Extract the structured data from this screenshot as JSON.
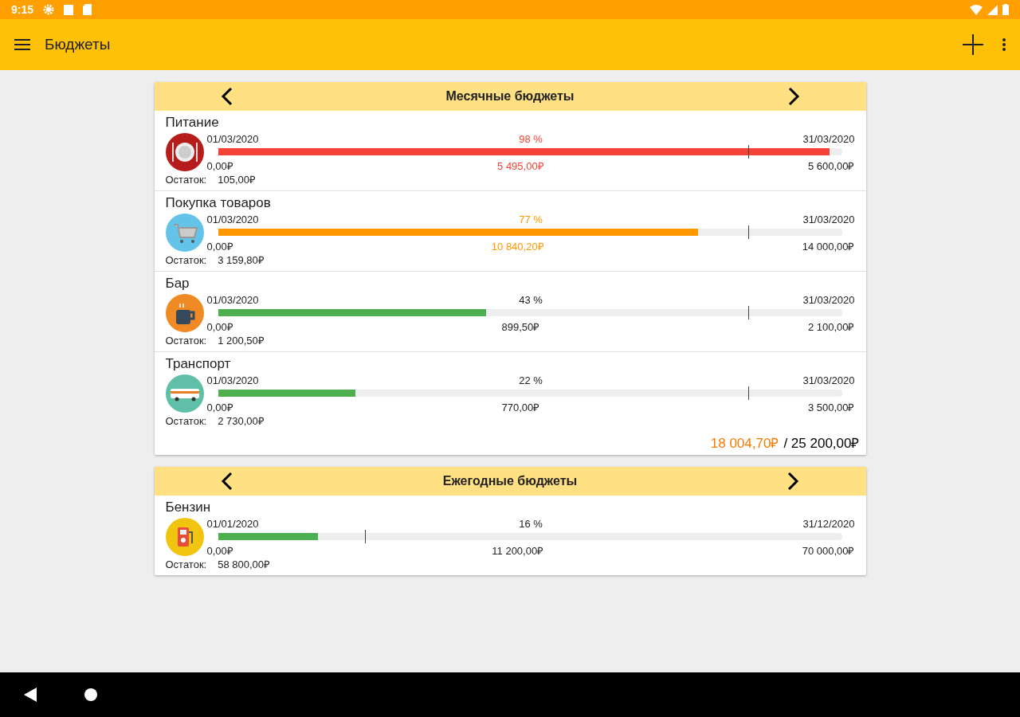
{
  "status_bar": {
    "time": "9:15"
  },
  "app_bar": {
    "title": "Бюджеты"
  },
  "sections": [
    {
      "title": "Месячные бюджеты",
      "budgets": [
        {
          "name": "Питание",
          "kind": "food",
          "color": "#f44336",
          "alert": true,
          "start_date": "01/03/2020",
          "end_date": "31/03/2020",
          "percent": "98 %",
          "level": 0.98,
          "today_marker": {
            "level": 0.85
          },
          "min": "0,00₽",
          "spent": "5 495,00₽",
          "limit": "5 600,00₽",
          "remainder_label": "Остаток:",
          "remainder": "105,00₽"
        },
        {
          "name": "Покупка товаров",
          "kind": "cart",
          "color": "#ff9800",
          "alert": true,
          "start_date": "01/03/2020",
          "end_date": "31/03/2020",
          "percent": "77 %",
          "level": 0.77,
          "today_marker": {
            "level": 0.85
          },
          "min": "0,00₽",
          "spent": "10 840,20₽",
          "limit": "14 000,00₽",
          "remainder_label": "Остаток:",
          "remainder": "3 159,80₽"
        },
        {
          "name": "Бар",
          "kind": "cup",
          "color": "#4caf50",
          "alert": false,
          "start_date": "01/03/2020",
          "end_date": "31/03/2020",
          "percent": "43 %",
          "level": 0.43,
          "today_marker": {
            "level": 0.85
          },
          "min": "0,00₽",
          "spent": "899,50₽",
          "limit": "2 100,00₽",
          "remainder_label": "Остаток:",
          "remainder": "1 200,50₽"
        },
        {
          "name": "Транспорт",
          "kind": "bus",
          "color": "#4caf50",
          "alert": false,
          "start_date": "01/03/2020",
          "end_date": "31/03/2020",
          "percent": "22 %",
          "level": 0.22,
          "today_marker": {
            "level": 0.85
          },
          "min": "0,00₽",
          "spent": "770,00₽",
          "limit": "3 500,00₽",
          "remainder_label": "Остаток:",
          "remainder": "2 730,00₽"
        }
      ],
      "total": {
        "spent": "18 004,70₽",
        "limit": "/ 25 200,00₽"
      }
    },
    {
      "title": "Ежегодные бюджеты",
      "budgets": [
        {
          "name": "Бензин",
          "kind": "fuel",
          "color": "#4caf50",
          "alert": false,
          "start_date": "01/01/2020",
          "end_date": "31/12/2020",
          "percent": "16 %",
          "level": 0.16,
          "today_marker": {
            "level": 0.235
          },
          "min": "0,00₽",
          "spent": "11 200,00₽",
          "limit": "70 000,00₽",
          "remainder_label": "Остаток:",
          "remainder": "58 800,00₽"
        }
      ]
    }
  ]
}
